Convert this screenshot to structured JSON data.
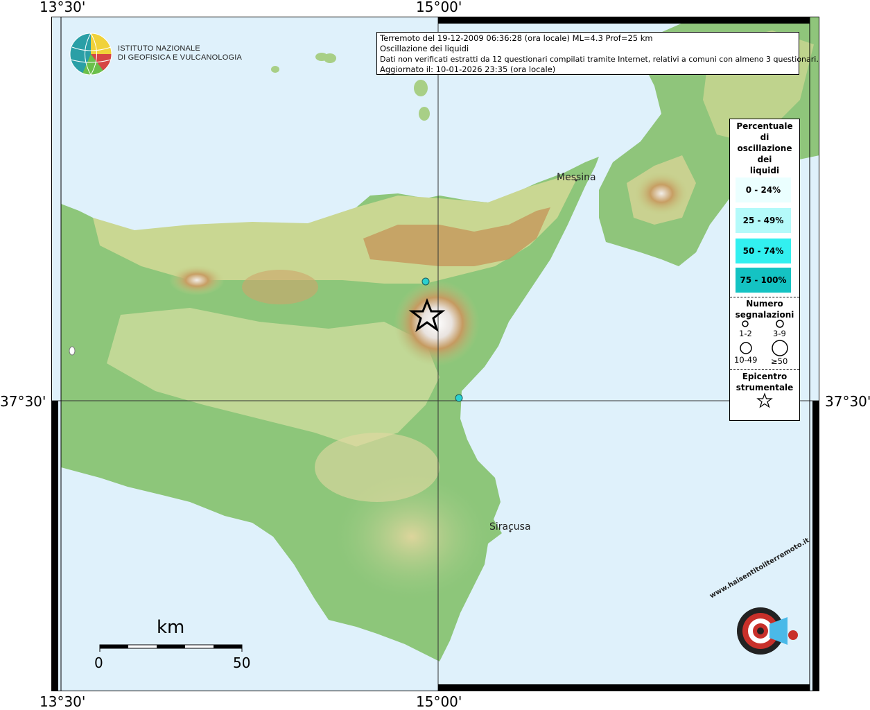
{
  "coords": {
    "top_left": "13°30'",
    "top_mid": "15°00'",
    "left_mid": "37°30'",
    "right_mid": "37°30'",
    "bottom_left": "13°30'",
    "bottom_mid": "15°00'"
  },
  "institute": {
    "line1": "ISTITUTO NAZIONALE",
    "line2": "DI GEOFISICA E VULCANOLOGIA"
  },
  "info": {
    "line1": "Terremoto del 19-12-2009 06:36:28 (ora locale) ML=4.3 Prof=25 km",
    "line2": "Oscillazione dei liquidi",
    "line3": "Dati non verificati estratti da 12 questionari compilati tramite Internet, relativi a comuni con almeno 3 questionari.",
    "line4": "Aggiornato il: 10-01-2026 23:35 (ora locale)"
  },
  "legend": {
    "title": "Percentuale\ndi\noscillazione\ndei\nliquidi",
    "ranges": [
      {
        "label": "0 - 24%",
        "color": "#ebffff"
      },
      {
        "label": "25 - 49%",
        "color": "#b4fafa"
      },
      {
        "label": "50 - 74%",
        "color": "#32f0f0"
      },
      {
        "label": "75 - 100%",
        "color": "#14c3c3"
      }
    ],
    "count_title": "Numero segnalazioni",
    "count_labels": [
      "1-2",
      "3-9",
      "10-49",
      "≥50"
    ],
    "epicenter_title": "Epicentro strumentale"
  },
  "cities": {
    "messina": "Messina",
    "siracusa": "Siracusa"
  },
  "scale": {
    "unit": "km",
    "min": "0",
    "max": "50"
  },
  "logo_text": "www.haisentitoilterremoto.it",
  "colors": {
    "sea": "#dff1fb",
    "land_low": "#7cbf78",
    "land_mid": "#c8d88f",
    "land_high": "#b98f4f",
    "marker": "#2ad0d0"
  }
}
